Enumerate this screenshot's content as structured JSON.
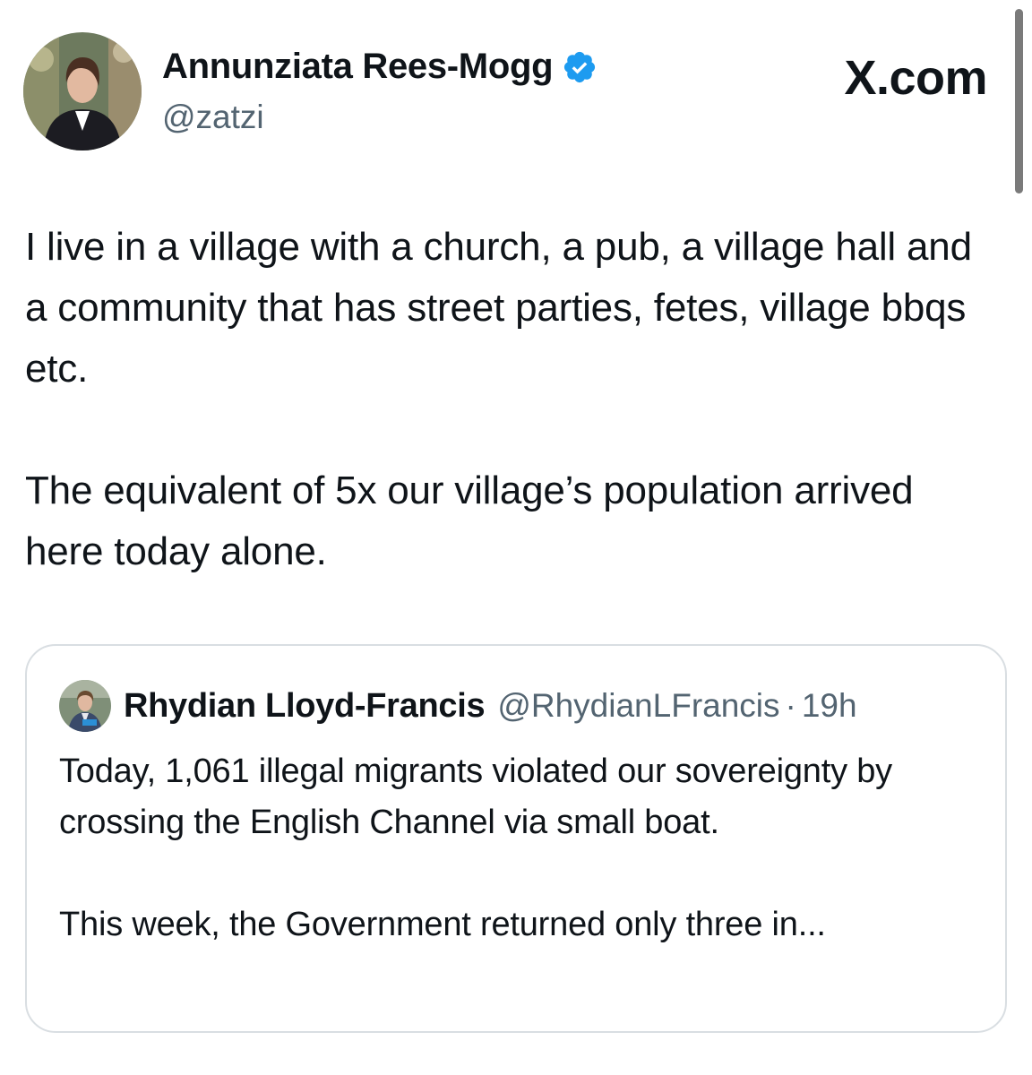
{
  "author": {
    "name": "Annunziata Rees-Mogg",
    "handle": "@zatzi",
    "verified_icon": "verified-badge-icon",
    "verified_color": "#1d9bf0"
  },
  "brand": {
    "label": "X.com"
  },
  "tweet": {
    "paragraphs": [
      "I live in a village with a church, a pub, a village hall and a community that has street parties, fetes, village bbqs etc.",
      "The equivalent of 5x our village’s population arrived here today alone."
    ]
  },
  "quote": {
    "name": "Rhydian Lloyd-Francis",
    "handle": "@RhydianLFrancis",
    "separator": "·",
    "time": "19h",
    "paragraphs": [
      "Today, 1,061 illegal migrants violated our sovereignty by crossing the English Channel via small boat.",
      "This week, the Government returned only three in..."
    ]
  },
  "colors": {
    "text": "#0f1419",
    "secondary": "#536471",
    "border": "#d9dee2"
  }
}
